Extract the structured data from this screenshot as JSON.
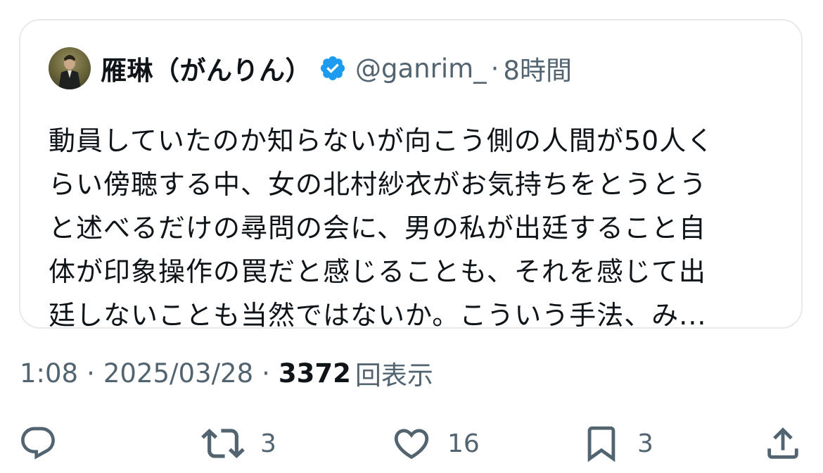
{
  "quoted_post": {
    "display_name": "雁琳（がんりん）",
    "handle": "@ganrim_",
    "separator": "·",
    "age": "8時間",
    "body_lines": [
      "動員していたのか知らないが向こう側の人間が50人く",
      "らい傍聴する中、女の北村紗衣がお気持ちをとうとう",
      "と述べるだけの尋問の会に、男の私が出廷すること自",
      "体が印象操作の罠だと感じることも、それを感じて出",
      "廷しないことも当然ではないか。こういう手法、み..."
    ],
    "avatar_icon": "user-avatar",
    "verified_icon": "verified-badge-icon",
    "verified_color": "#1d9bf0"
  },
  "meta": {
    "time": "1:08",
    "sep1": "·",
    "date": "2025/03/28",
    "sep2": "·",
    "views_count": "3372",
    "views_label": "回表示"
  },
  "actions": {
    "reply": {
      "icon": "reply-icon",
      "count": ""
    },
    "retweet": {
      "icon": "retweet-icon",
      "count": "3"
    },
    "like": {
      "icon": "heart-icon",
      "count": "16"
    },
    "bookmark": {
      "icon": "bookmark-icon",
      "count": "3"
    },
    "share": {
      "icon": "share-icon",
      "count": ""
    }
  },
  "colors": {
    "text_primary": "#0f1419",
    "text_secondary": "#536471",
    "border": "#e7e9ea"
  }
}
